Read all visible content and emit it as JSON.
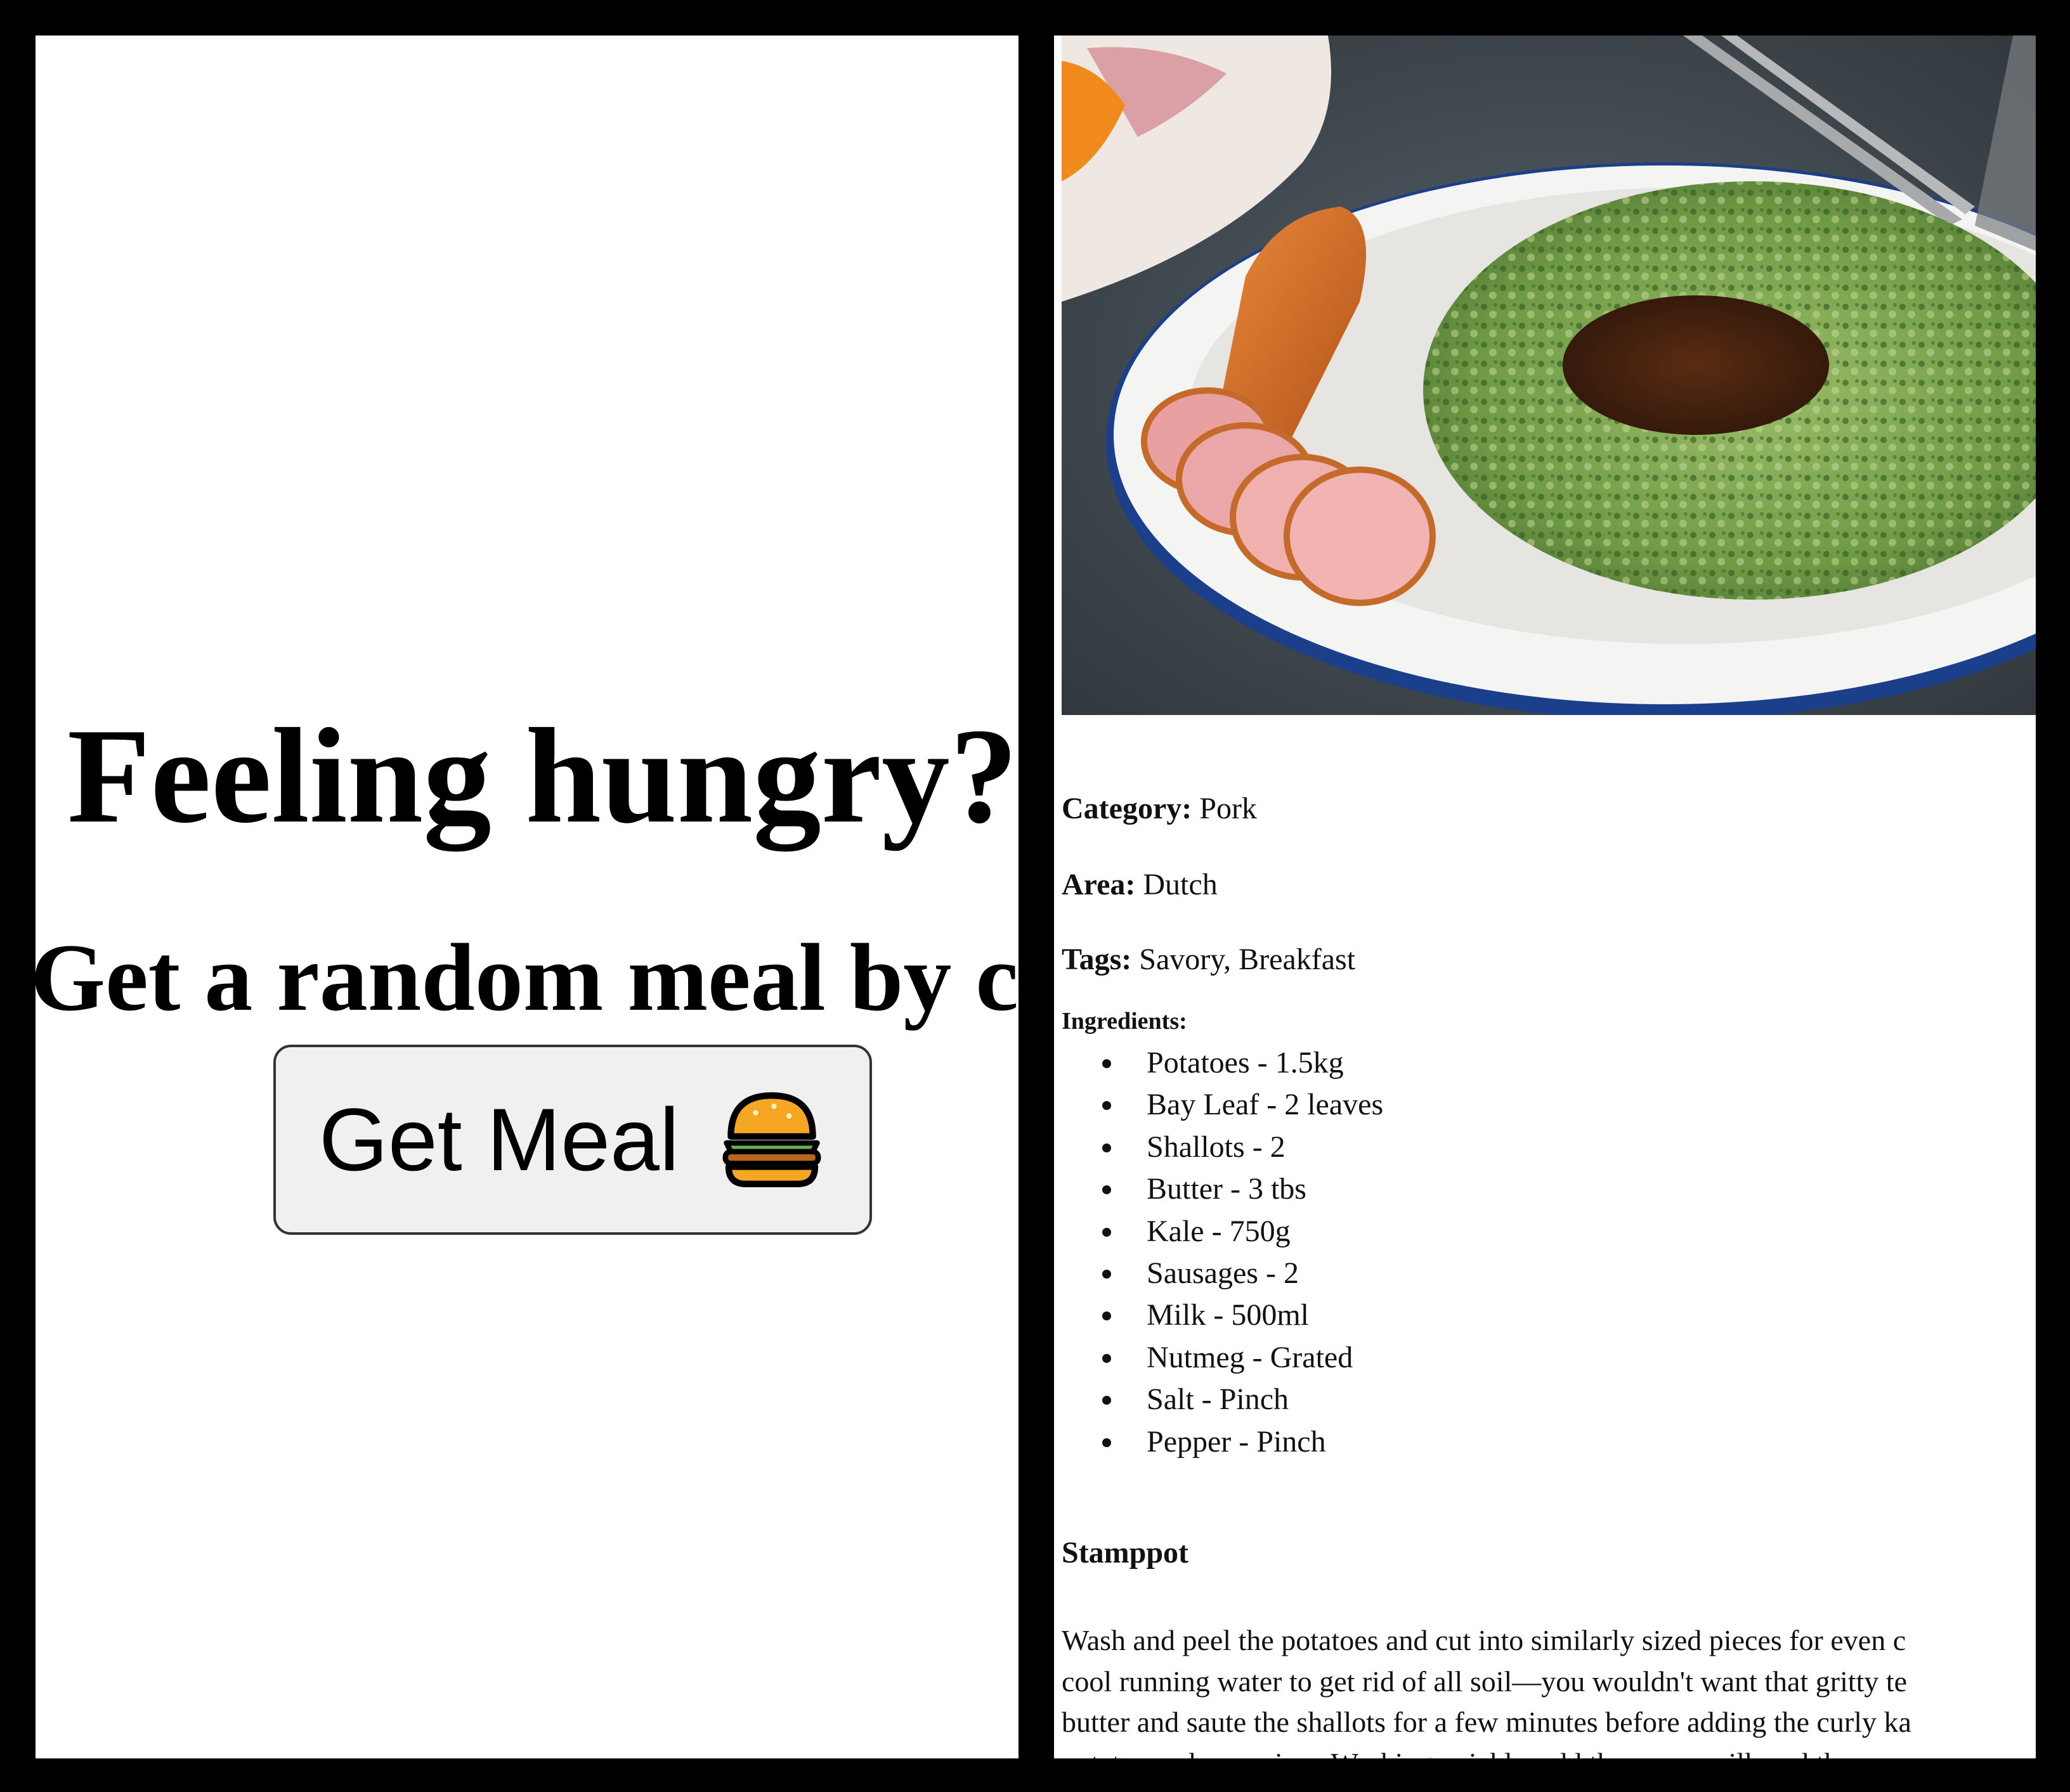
{
  "hero": {
    "title": "Feeling hungry?",
    "subtitle": "Get a random meal by clicking below",
    "button_label": "Get Meal"
  },
  "meal": {
    "category_label": "Category:",
    "category": "Pork",
    "area_label": "Area:",
    "area": "Dutch",
    "tags_label": "Tags:",
    "tags": "Savory, Breakfast",
    "ingredients_heading": "Ingredients:",
    "ingredients": [
      "Potatoes - 1.5kg",
      "Bay Leaf - 2 leaves",
      "Shallots - 2",
      "Butter - 3 tbs",
      "Kale - 750g",
      "Sausages - 2",
      "Milk - 500ml",
      "Nutmeg - Grated",
      "Salt - Pinch",
      "Pepper - Pinch"
    ],
    "name": "Stamppot",
    "instructions_lines": [
      "Wash and peel the potatoes and cut into similarly sized pieces for even c",
      "cool running water to get rid of all soil—you wouldn't want that gritty te",
      "butter and saute the shallots for a few minutes before adding the curly ka",
      "potato masher or ricer. Working quickly, add the warm milk and the rem"
    ]
  },
  "icons": {
    "button_icon": "hamburger-icon"
  }
}
